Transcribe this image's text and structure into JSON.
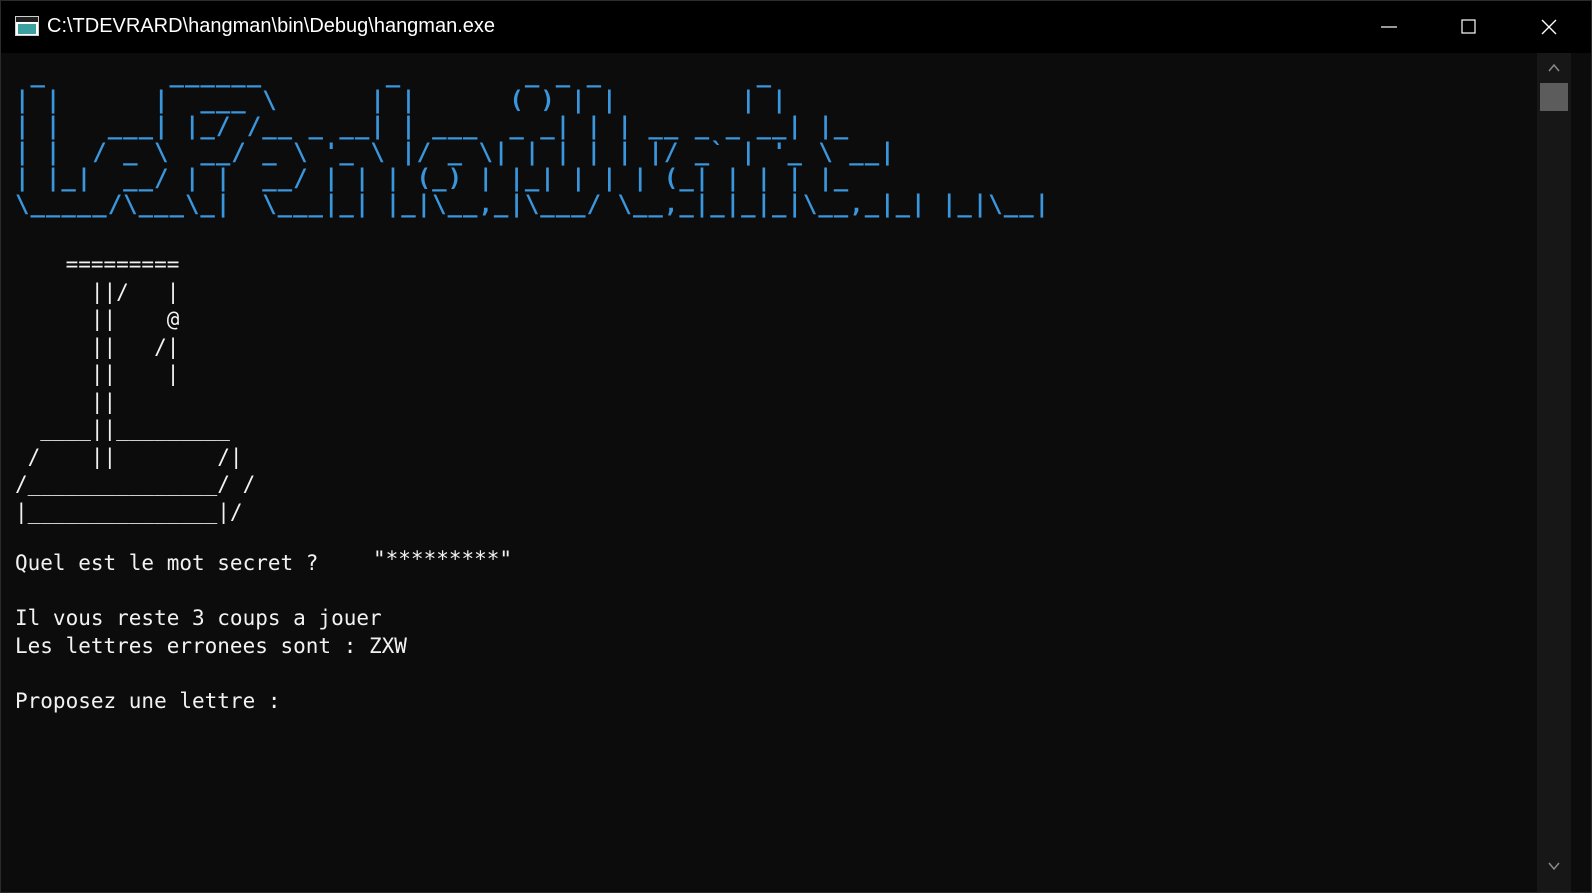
{
  "window": {
    "title": "C:\\TDEVRARD\\hangman\\bin\\Debug\\hangman.exe",
    "controls": {
      "minimize": "minimize-icon",
      "maximize": "maximize-icon",
      "close": "close-icon"
    }
  },
  "console": {
    "banner": " _        ______        _        _ _ _          _\n| |      |  ___ \\      | |      ( ) | |        | |\n| |   ___| |_/ /__ _ __| | ___  _ _| | | __ _ _ __| |_\n| |  / _ \\  __/ _ \\ '_ \\ |/ _ \\| | | | | |/ _` | '_ \\ __|\n| |_|  __/ | |  __/ | | | (_) | |_| | | | (_| | | | |_\n\\_____/\\___\\_|  \\___|_| |_|\\__,_|\\___/ \\__,_|_|_|_|\\__,_|_| |_|\\__|",
    "gallows": "    =========\n      ||/   |\n      ||    @\n      ||   /|\n      ||    |\n      ||\n  ____||_________\n /    ||        /|\n/_______________/ /\n|_______________|/",
    "question": "Quel est le mot secret ?",
    "secret_word": "\"*********\"",
    "remaining": "Il vous reste 3 coups a jouer",
    "wrong_letters": "Les lettres erronees sont : ZXW",
    "prompt": "Proposez une lettre :"
  },
  "colors": {
    "background": "#0c0c0c",
    "banner": "#3a96dd",
    "text": "#f2f2f2",
    "titlebar": "#000000"
  }
}
